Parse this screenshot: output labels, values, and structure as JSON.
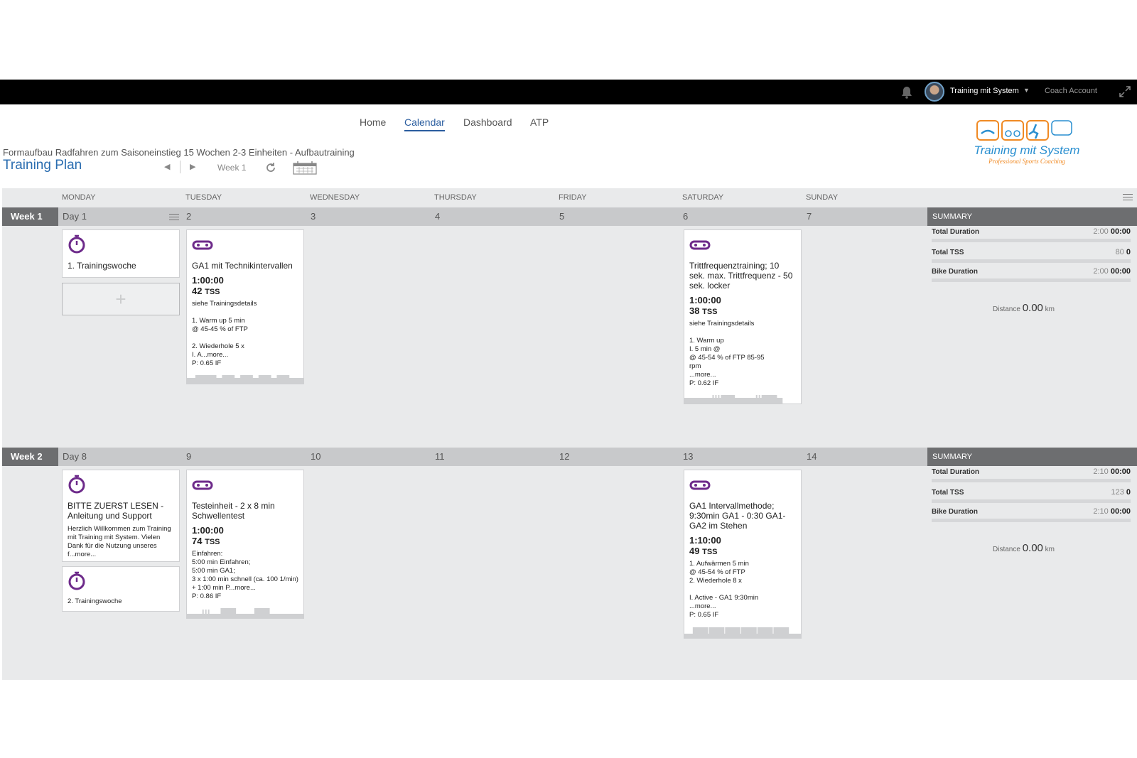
{
  "topbar": {
    "user_name": "Training mit System",
    "coach_link": "Coach Account"
  },
  "nav": {
    "items": [
      "Home",
      "Calendar",
      "Dashboard",
      "ATP"
    ],
    "active": "Calendar"
  },
  "plan": {
    "subtitle": "Formaufbau Radfahren zum Saisoneinstieg 15 Wochen 2-3 Einheiten - Aufbautraining",
    "title": "Training Plan",
    "week_label": "Week 1"
  },
  "logo": {
    "text": "Training mit System",
    "tagline": "Professional Sports Coaching"
  },
  "day_headers": [
    "MONDAY",
    "TUESDAY",
    "WEDNESDAY",
    "THURSDAY",
    "FRIDAY",
    "SATURDAY",
    "SUNDAY"
  ],
  "summary_label": "SUMMARY",
  "weeks": [
    {
      "label": "Week 1",
      "days": [
        "Day 1",
        "2",
        "3",
        "4",
        "5",
        "6",
        "7"
      ],
      "summary": {
        "total_duration_label": "Total Duration",
        "total_duration_planned": "2:00",
        "total_duration_actual": "00:00",
        "total_tss_label": "Total TSS",
        "total_tss_planned": "80",
        "total_tss_actual": "0",
        "bike_duration_label": "Bike Duration",
        "bike_duration_planned": "2:00",
        "bike_duration_actual": "00:00",
        "distance_label": "Distance",
        "distance_value": "0.00",
        "distance_unit": "km"
      },
      "cards": {
        "mon_note": {
          "title": "1. Trainingswoche"
        },
        "tue": {
          "title": "GA1 mit Technikintervallen",
          "duration": "1:00:00",
          "tss": "42",
          "tss_unit": "TSS",
          "desc": "siehe Trainingsdetails\n\n1. Warm up 5 min\n    @ 45-45 % of FTP\n\n2. Wiederhole 5 x\n    I. A...more...",
          "pif": "P: 0.65 IF"
        },
        "sat": {
          "title": "Trittfrequenztraining; 10 sek. max. Trittfrequenz - 50 sek. locker",
          "duration": "1:00:00",
          "tss": "38",
          "tss_unit": "TSS",
          "desc": "siehe Trainingsdetails\n\n1. Warm up\n    I. 5 min @\n       @ 45-54 % of FTP 85-95\nrpm\n    ...more...",
          "pif": "P: 0.62 IF"
        }
      }
    },
    {
      "label": "Week 2",
      "days": [
        "Day 8",
        "9",
        "10",
        "11",
        "12",
        "13",
        "14"
      ],
      "summary": {
        "total_duration_label": "Total Duration",
        "total_duration_planned": "2:10",
        "total_duration_actual": "00:00",
        "total_tss_label": "Total TSS",
        "total_tss_planned": "123",
        "total_tss_actual": "0",
        "bike_duration_label": "Bike Duration",
        "bike_duration_planned": "2:10",
        "bike_duration_actual": "00:00",
        "distance_label": "Distance",
        "distance_value": "0.00",
        "distance_unit": "km"
      },
      "cards": {
        "mon_note1": {
          "title": "BITTE ZUERST LESEN - Anleitung und Support",
          "desc": "Herzlich Willkommen zum Training mit Training mit System. Vielen Dank für die Nutzung unseres f...more..."
        },
        "mon_note2": {
          "title": "2. Trainingswoche"
        },
        "tue": {
          "title": "Testeinheit - 2 x 8 min Schwellentest",
          "duration": "1:00:00",
          "tss": "74",
          "tss_unit": "TSS",
          "desc": "Einfahren:\n5:00 min Einfahren;\n5:00 min GA1;\n3 x 1:00 min schnell (ca. 100 1/min) + 1:00 min P...more...",
          "pif": "P: 0.86 IF"
        },
        "sat": {
          "title": "GA1 Intervallmethode; 9:30min GA1 - 0:30 GA1-GA2 im Stehen",
          "duration": "1:10:00",
          "tss": "49",
          "tss_unit": "TSS",
          "desc": "1. Aufwärmen 5 min\n    @ 45-54 % of FTP\n2. Wiederhole 8 x\n\n  I. Active - GA1 9:30min\n    ...more...",
          "pif": "P: 0.65 IF"
        }
      }
    }
  ]
}
